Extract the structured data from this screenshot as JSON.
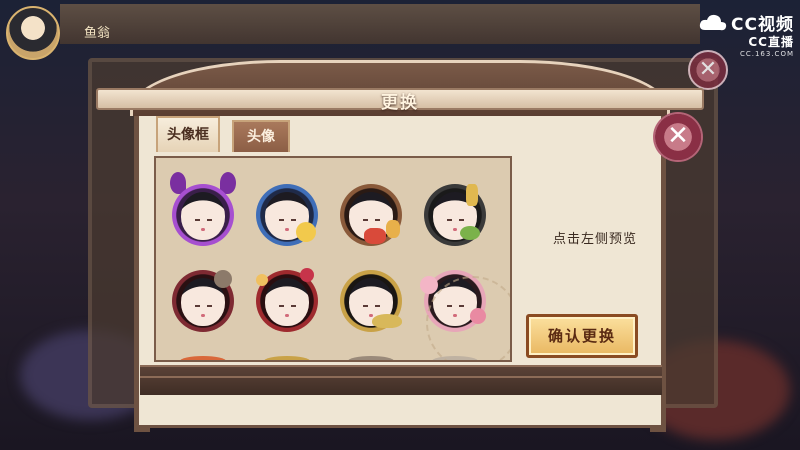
{
  "background": {
    "player_name": "鱼翁",
    "watermark_brand": "CC视频",
    "watermark_live": "CC直播",
    "watermark_url": "CC.163.COM"
  },
  "dialog": {
    "title": "更换",
    "tabs": [
      {
        "label": "头像框",
        "active": true
      },
      {
        "label": "头像",
        "active": false
      }
    ],
    "preview_hint": "点击左侧预览",
    "confirm_label": "确认更换",
    "close_glyph": "✕"
  },
  "frames": [
    {
      "name": "oni-horn-purple-frame",
      "ring": "#6a2d8e",
      "accent": "#b84fd4"
    },
    {
      "name": "wave-moon-blue-frame",
      "ring": "#2e4f8e",
      "accent": "#f2c94c"
    },
    {
      "name": "lantern-festival-frame",
      "ring": "#6b3b2a",
      "accent": "#d94a3a"
    },
    {
      "name": "gold-sprout-frame",
      "ring": "#2a2a2a",
      "accent": "#7bb24a"
    },
    {
      "name": "dark-scroll-frame",
      "ring": "#6e2b30",
      "accent": "#c7344a"
    },
    {
      "name": "crimson-blossom-frame",
      "ring": "#6b1f24",
      "accent": "#f0c060"
    },
    {
      "name": "golden-dragon-frame",
      "ring": "#c9a247",
      "accent": "#f5d88a"
    },
    {
      "name": "sakura-pink-frame",
      "ring": "#e7a6b8",
      "accent": "#f6d4de"
    }
  ],
  "colors": {
    "accent_gold": "#e9b761",
    "wood_brown": "#6e5242",
    "paper": "#efe6d4"
  }
}
